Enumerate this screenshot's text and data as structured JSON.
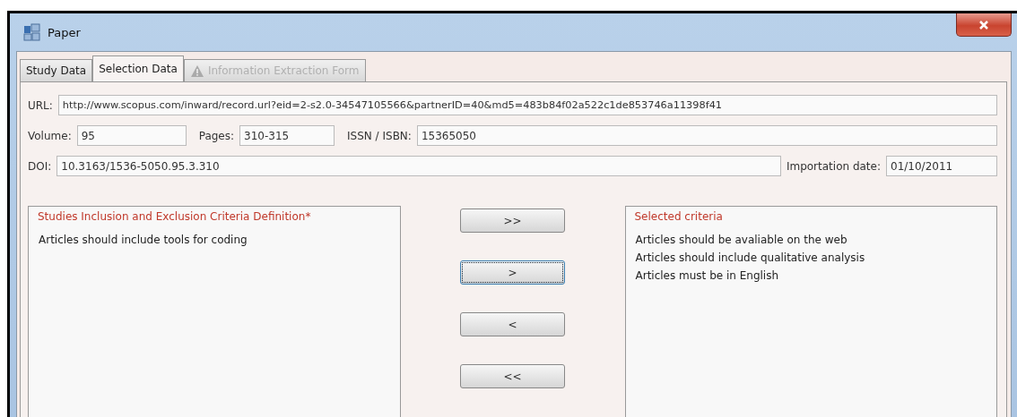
{
  "window": {
    "title": "Paper"
  },
  "tabs": [
    {
      "label": "Study Data",
      "selected": false,
      "disabled": false
    },
    {
      "label": "Selection Data",
      "selected": true,
      "disabled": false
    },
    {
      "label": "Information Extraction Form",
      "selected": false,
      "disabled": true,
      "warning": true
    }
  ],
  "url": {
    "label": "URL:",
    "value": "http://www.scopus.com/inward/record.url?eid=2-s2.0-34547105566&partnerID=40&md5=483b84f02a522c1de853746a11398f41"
  },
  "volume": {
    "label": "Volume:",
    "value": "95"
  },
  "pages": {
    "label": "Pages:",
    "value": "310-315"
  },
  "issn": {
    "label": "ISSN / ISBN:",
    "value": "15365050"
  },
  "doi": {
    "label": "DOI:",
    "value": "10.3163/1536-5050.95.3.310"
  },
  "importation_date": {
    "label": "Importation date:",
    "value": "01/10/2011"
  },
  "available_criteria": {
    "title": "Studies Inclusion and Exclusion Criteria Definition*",
    "items": [
      "Articles should include tools for coding"
    ]
  },
  "move_buttons": [
    {
      "label": ">>",
      "focused": false
    },
    {
      "label": ">",
      "focused": true
    },
    {
      "label": "<",
      "focused": false
    },
    {
      "label": "<<",
      "focused": false
    }
  ],
  "selected_criteria": {
    "title": "Selected criteria",
    "items": [
      "Articles should be avaliable on the web",
      "Articles should include qualitative analysis",
      "Articles must be in English"
    ]
  }
}
